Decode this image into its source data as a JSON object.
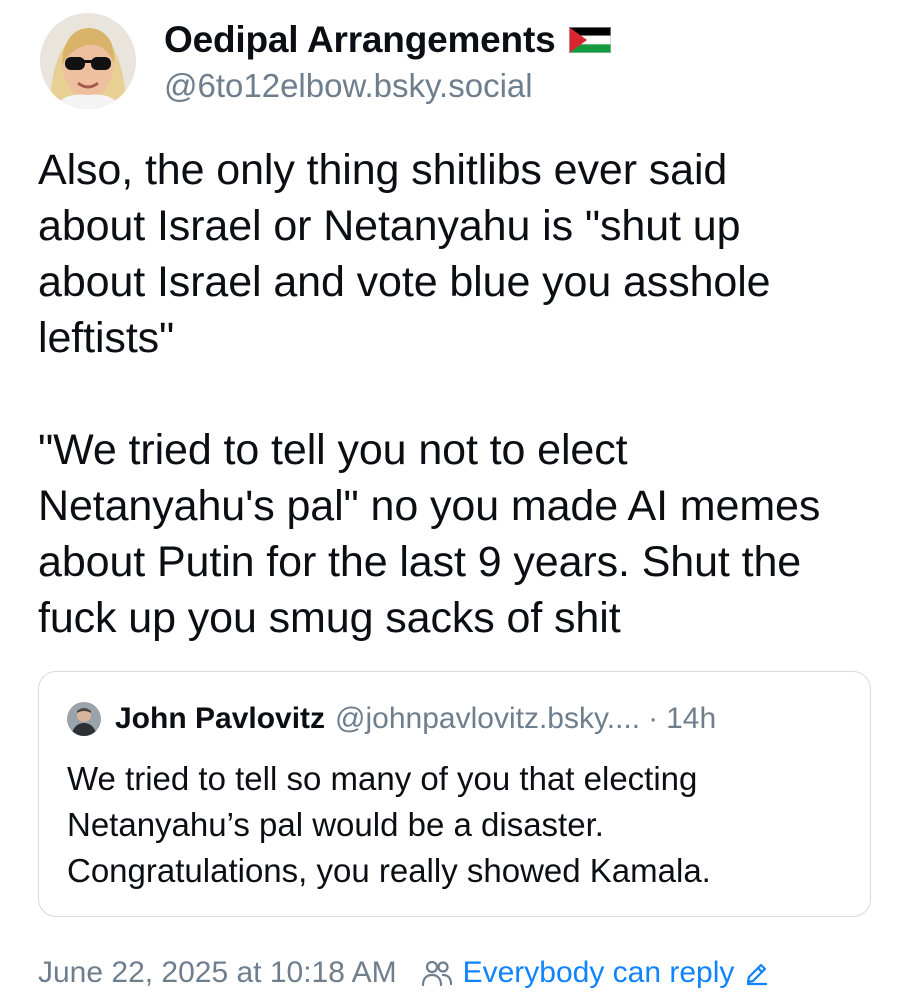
{
  "post": {
    "author": {
      "display_name": "Oedipal Arrangements",
      "handle": "@6to12elbow.bsky.social",
      "flag_icon": "palestine-flag-icon"
    },
    "text": "Also, the only thing shitlibs ever said\nabout Israel or Netanyahu is \"shut up\nabout Israel and vote blue you asshole\nleftists\"\n\n\"We tried to tell you not to elect\nNetanyahu's pal\" no you made AI memes\nabout Putin for the last 9 years. Shut the\nfuck up you smug sacks of shit",
    "quote": {
      "display_name": "John Pavlovitz",
      "handle": "@johnpavlovitz.bsky....",
      "separator": "·",
      "time": "14h",
      "text": "We tried to tell so many of you that electing\nNetanyahu’s pal would be a disaster.\nCongratulations, you really showed Kamala."
    },
    "timestamp": "June 22, 2025 at 10:18 AM",
    "reply_setting": {
      "label": "Everybody can reply",
      "icon": "people-icon",
      "edit_icon": "pencil-icon"
    }
  },
  "colors": {
    "text": "#0b0f14",
    "muted": "#6f7e8c",
    "link": "#1083fe",
    "border": "#d4dbe2"
  }
}
